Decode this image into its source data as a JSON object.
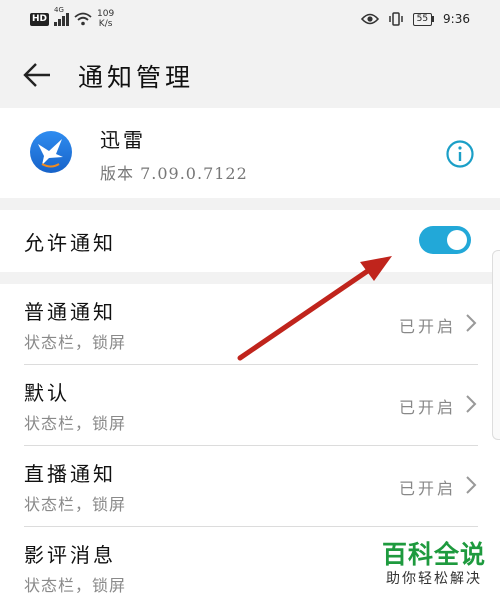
{
  "status_bar": {
    "hd": "HD",
    "network": "4G",
    "speed_value": "109",
    "speed_unit": "K/s",
    "battery": "55",
    "time": "9:36"
  },
  "header": {
    "title": "通知管理",
    "back_icon": "arrow-left-icon"
  },
  "app": {
    "name": "迅雷",
    "version": "版本 7.09.0.7122",
    "icon": "xunlei-bird-icon",
    "info_icon": "info-icon"
  },
  "allow_notifications": {
    "label": "允许通知",
    "enabled": true,
    "toggle_color": "#22a8d8"
  },
  "channels": [
    {
      "title": "普通通知",
      "subtitle": "状态栏，锁屏",
      "status": "已开启"
    },
    {
      "title": "默认",
      "subtitle": "状态栏，锁屏",
      "status": "已开启"
    },
    {
      "title": "直播通知",
      "subtitle": "状态栏，锁屏",
      "status": "已开启"
    },
    {
      "title": "影评消息",
      "subtitle": "状态栏，锁屏",
      "status": ""
    }
  ],
  "watermark": {
    "main": "百科全说",
    "sub": "助你轻松解决"
  },
  "colors": {
    "accent": "#22a8d8",
    "annotation_arrow": "#c0241c",
    "watermark_green": "#1e9a3e"
  }
}
